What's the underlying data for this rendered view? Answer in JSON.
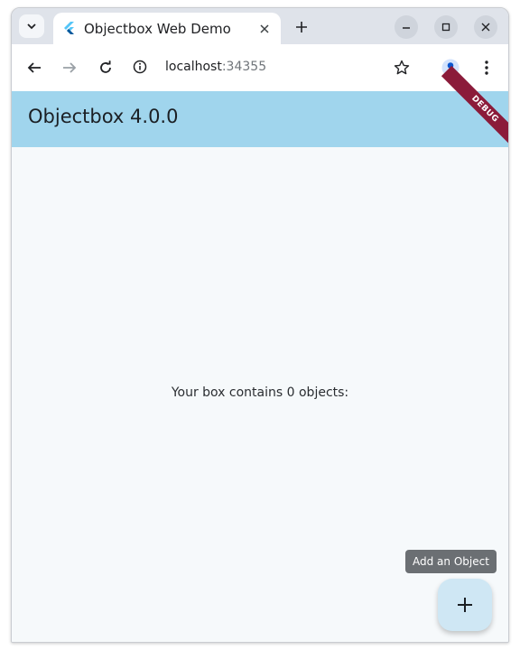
{
  "browser": {
    "tab": {
      "title": "Objectbox Web Demo"
    },
    "address": {
      "host": "localhost",
      "port": ":34355"
    }
  },
  "app": {
    "title": "Objectbox 4.0.0",
    "debug_banner": "DEBUG",
    "message": "Your box contains 0 objects:",
    "fab_tooltip": "Add an Object",
    "colors": {
      "appbar": "#a0d5ed",
      "background": "#f6f9fb",
      "debug": "#8b1b3a",
      "fab": "#cfe7f4"
    }
  },
  "icons": {
    "tab_search": "chevron-down-icon",
    "favicon": "flutter-icon",
    "close_tab": "close-icon",
    "new_tab": "plus-icon",
    "minimize": "minimize-icon",
    "maximize": "maximize-icon",
    "close_window": "close-icon",
    "back": "arrow-left-icon",
    "forward": "arrow-right-icon",
    "reload": "reload-icon",
    "site_info": "info-icon",
    "bookmark": "star-icon",
    "profile": "person-icon",
    "menu": "more-vert-icon",
    "fab": "plus-icon"
  }
}
